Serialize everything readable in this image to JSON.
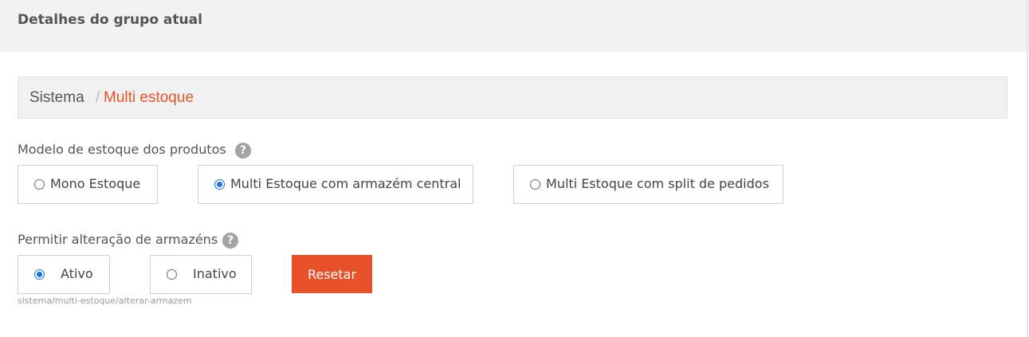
{
  "header": {
    "title": "Detalhes do grupo atual"
  },
  "breadcrumb": {
    "root": "Sistema",
    "separator": "/",
    "current": "Multi estoque"
  },
  "stock_model": {
    "label": "Modelo de estoque dos produtos",
    "help": "?",
    "options": [
      {
        "label": "Mono Estoque",
        "checked": false
      },
      {
        "label": "Multi Estoque com armazém central",
        "checked": true
      },
      {
        "label": "Multi Estoque com split de pedidos",
        "checked": false
      }
    ]
  },
  "warehouse_change": {
    "label": "Permitir alteração de armazéns",
    "help": "?",
    "options": [
      {
        "label": "Ativo",
        "checked": true
      },
      {
        "label": "Inativo",
        "checked": false
      }
    ],
    "reset_label": "Resetar",
    "path_hint": "sistema/multi-estoque/alterar-armazem"
  },
  "colors": {
    "accent": "#e8522a",
    "radio": "#1a73e8"
  }
}
